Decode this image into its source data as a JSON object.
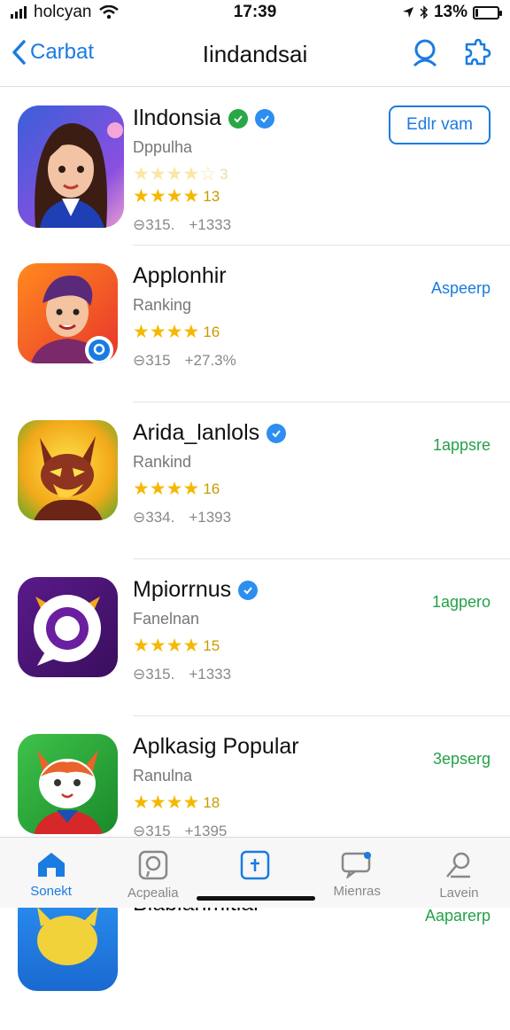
{
  "status": {
    "carrier": "holcyan",
    "time": "17:39",
    "battery": "13%",
    "battery_level": 0.13
  },
  "nav": {
    "back_label": "Carbat",
    "title": "Iindandsai"
  },
  "apps": [
    {
      "name": "Ilndonsia",
      "subtitle": "Dppulha",
      "rating": "13",
      "rating_top": "3",
      "meta_a": "⊖315.",
      "meta_b": "+1333",
      "action": "Edlr vam"
    },
    {
      "name": "Applonhir",
      "subtitle": "Ranking",
      "rating": "16",
      "meta_a": "⊖315",
      "meta_b": "+27.3%",
      "action": "Aspeerp"
    },
    {
      "name": "Arida_lanlols",
      "subtitle": "Rankind",
      "rating": "16",
      "meta_a": "⊖334.",
      "meta_b": "+1393",
      "action": "1appsre"
    },
    {
      "name": "Mpiorrnus",
      "subtitle": "Fanelnan",
      "rating": "15",
      "meta_a": "⊖315.",
      "meta_b": "+1333",
      "action": "1agpero"
    },
    {
      "name": "Aplkasig Popular",
      "subtitle": "Ranulna",
      "rating": "18",
      "meta_a": "⊖315",
      "meta_b": "+1395",
      "action": "3epserg"
    },
    {
      "name": "Blablahmltiar",
      "action": "Aaparerp"
    }
  ],
  "tabs": [
    {
      "label": "Sonekt",
      "icon": "home-icon"
    },
    {
      "label": "Acpealia",
      "icon": "search-icon"
    },
    {
      "label": "",
      "icon": "add-icon"
    },
    {
      "label": "Mienras",
      "icon": "messages-icon"
    },
    {
      "label": "Lavein",
      "icon": "profile-icon"
    }
  ],
  "colors": {
    "accent": "#1a7be0",
    "green": "#24a148",
    "star": "#f5b800"
  }
}
